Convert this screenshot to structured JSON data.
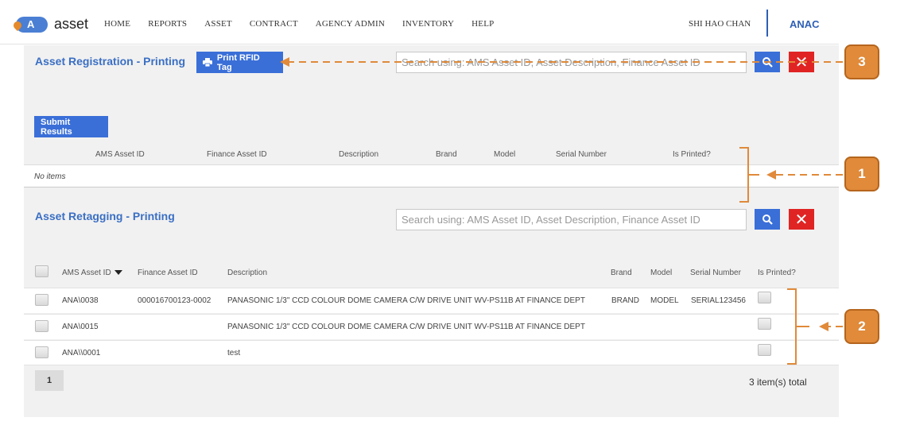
{
  "app": {
    "logo_letter": "A",
    "logo_text": "asset"
  },
  "nav": {
    "items": [
      "HOME",
      "REPORTS",
      "ASSET",
      "CONTRACT",
      "AGENCY ADMIN",
      "INVENTORY",
      "HELP"
    ],
    "user": "SHI HAO CHAN",
    "org": "ANAC"
  },
  "registration": {
    "title": "Asset Registration - Printing",
    "print_button": "Print RFID Tag",
    "search_placeholder": "Search using: AMS Asset ID, Asset Description, Finance Asset ID",
    "submit_button": "Submit Results",
    "columns": [
      "AMS Asset ID",
      "Finance Asset ID",
      "Description",
      "Brand",
      "Model",
      "Serial Number",
      "Is Printed?"
    ],
    "empty_text": "No items"
  },
  "retagging": {
    "title": "Asset Retagging - Printing",
    "search_placeholder": "Search using: AMS Asset ID, Asset Description, Finance Asset ID",
    "columns": [
      "AMS Asset ID",
      "Finance Asset ID",
      "Description",
      "Brand",
      "Model",
      "Serial Number",
      "Is Printed?"
    ],
    "sort_icon": "sort-desc-icon",
    "rows": [
      {
        "ams_id": "ANA\\0038",
        "finance_id": "000016700123-0002",
        "description": "PANASONIC 1/3\" CCD COLOUR DOME CAMERA C/W DRIVE UNIT WV-PS11B AT FINANCE DEPT",
        "brand": "BRAND",
        "model": "MODEL",
        "serial": "SERIAL123456"
      },
      {
        "ams_id": "ANA\\0015",
        "finance_id": "",
        "description": "PANASONIC 1/3\" CCD COLOUR DOME CAMERA C/W DRIVE UNIT WV-PS11B AT FINANCE DEPT",
        "brand": "",
        "model": "",
        "serial": ""
      },
      {
        "ams_id": "ANA\\\\0001",
        "finance_id": "",
        "description": "test",
        "brand": "",
        "model": "",
        "serial": ""
      }
    ],
    "page": "1",
    "total": "3 item(s) total"
  },
  "annotations": {
    "callout_1": "1",
    "callout_2": "2",
    "callout_3": "3"
  },
  "colors": {
    "accent": "#3a6fd8",
    "title": "#3a6fc4",
    "danger": "#e02424",
    "annotation": "#e08a3a"
  }
}
